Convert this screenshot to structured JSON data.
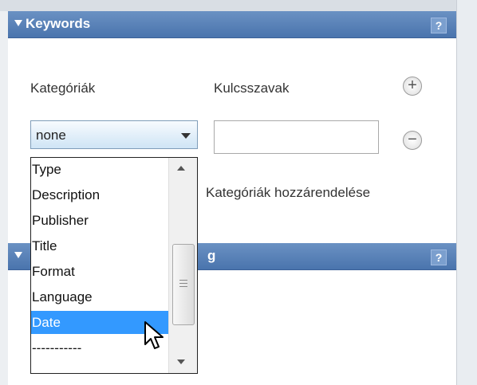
{
  "keywords_panel": {
    "title": "Keywords",
    "help": "?",
    "categories_label": "Kategóriák",
    "keywords_label": "Kulcsszavak",
    "add_symbol": "+",
    "remove_symbol": "−",
    "assign_label": "Kategóriák hozzárendelése",
    "select_value": "none",
    "keyword_input_value": ""
  },
  "second_panel": {
    "title_fragment": "g",
    "help": "?"
  },
  "dropdown": {
    "options": [
      "Type",
      "Description",
      "Publisher",
      "Title",
      "Format",
      "Language",
      "Date",
      "-----------"
    ],
    "selected_index": 6
  },
  "colors": {
    "header": "#4a74ad",
    "selection": "#3399ff"
  }
}
